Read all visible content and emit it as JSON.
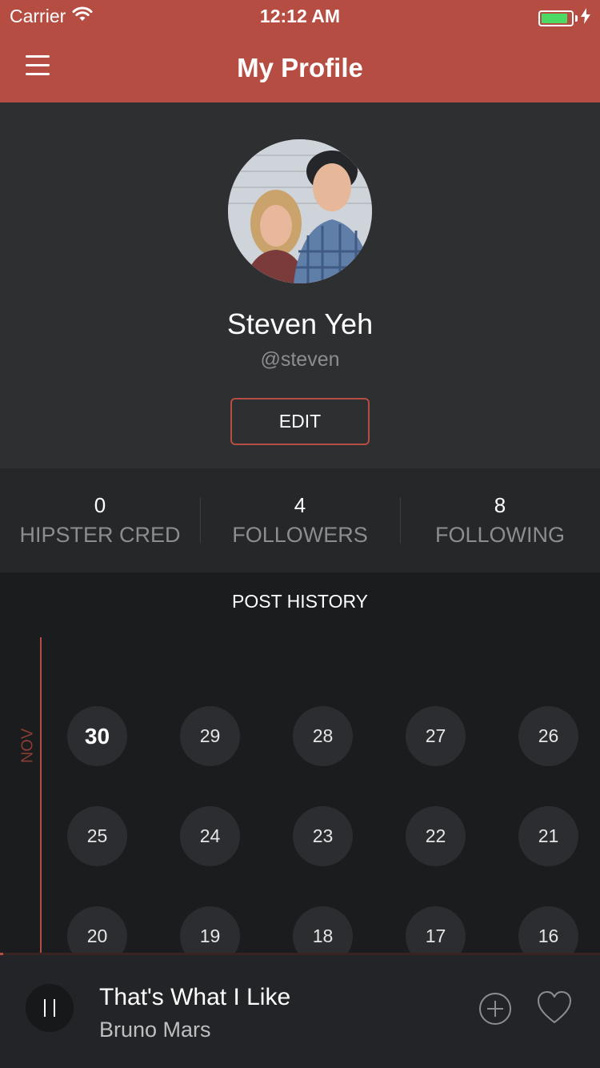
{
  "status_bar": {
    "carrier": "Carrier",
    "time": "12:12 AM",
    "battery_level": 0.9,
    "battery_color": "#4cd964"
  },
  "nav": {
    "title": "My Profile",
    "menu_icon": "hamburger-menu-icon"
  },
  "profile": {
    "name": "Steven Yeh",
    "handle": "@steven",
    "edit_label": "EDIT"
  },
  "stats": [
    {
      "value": "0",
      "label": "HIPSTER CRED"
    },
    {
      "value": "4",
      "label": "FOLLOWERS"
    },
    {
      "value": "8",
      "label": "FOLLOWING"
    }
  ],
  "history": {
    "title": "POST HISTORY",
    "month": "NOV",
    "days": [
      "30",
      "29",
      "28",
      "27",
      "26",
      "25",
      "24",
      "23",
      "22",
      "21",
      "20",
      "19",
      "18",
      "17",
      "16"
    ],
    "highlighted_day": "30"
  },
  "player": {
    "title": "That's What I Like",
    "artist": "Bruno Mars",
    "progress": 0.005,
    "state": "playing"
  },
  "colors": {
    "accent": "#b54d43",
    "background": "#1b1c1e",
    "profile_background": "#2e2f31",
    "stats_background": "#262729"
  }
}
